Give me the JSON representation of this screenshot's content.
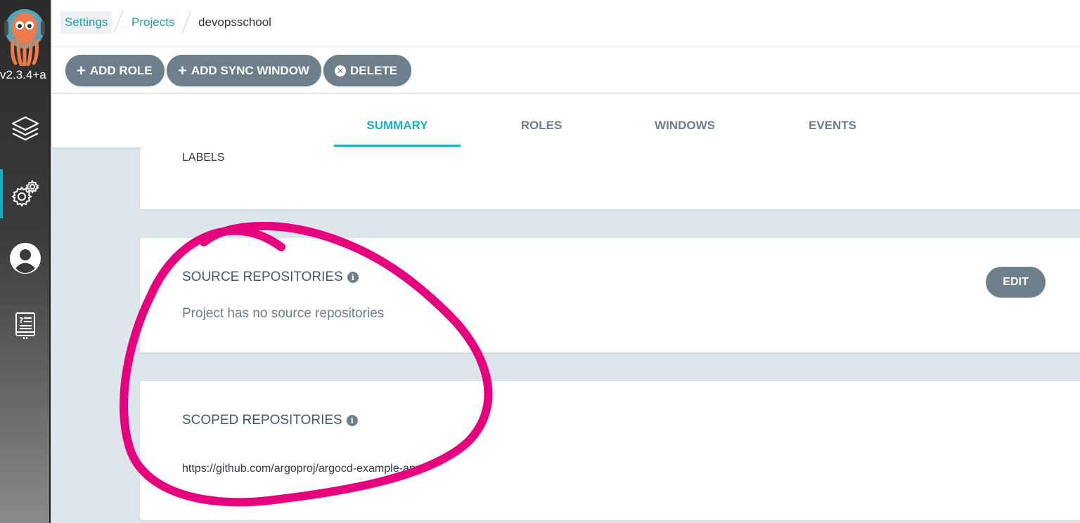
{
  "app": {
    "version": "v2.3.4+a"
  },
  "sidebar": {
    "items": [
      {
        "icon": "layers-icon",
        "name": "applications"
      },
      {
        "icon": "gear-icon",
        "name": "settings",
        "active": true
      },
      {
        "icon": "user-icon",
        "name": "user-info"
      },
      {
        "icon": "docs-icon",
        "name": "documentation"
      }
    ]
  },
  "breadcrumb": {
    "items": [
      "Settings",
      "Projects",
      "devopsschool"
    ]
  },
  "toolbar": {
    "add_role": "ADD ROLE",
    "add_sync_window": "ADD SYNC WINDOW",
    "delete": "DELETE"
  },
  "tabs": {
    "items": [
      "SUMMARY",
      "ROLES",
      "WINDOWS",
      "EVENTS"
    ],
    "active": "SUMMARY"
  },
  "labels_card": {
    "title": "LABELS"
  },
  "source_repos": {
    "title": "SOURCE REPOSITORIES",
    "empty_text": "Project has no source repositories",
    "edit_label": "EDIT"
  },
  "scoped_repos": {
    "title": "SCOPED REPOSITORIES",
    "items": [
      "https://github.com/argoproj/argocd-example-apps"
    ]
  },
  "colors": {
    "accent": "#18b0c1",
    "button": "#6d7f8b",
    "annotation": "#e6007e"
  }
}
